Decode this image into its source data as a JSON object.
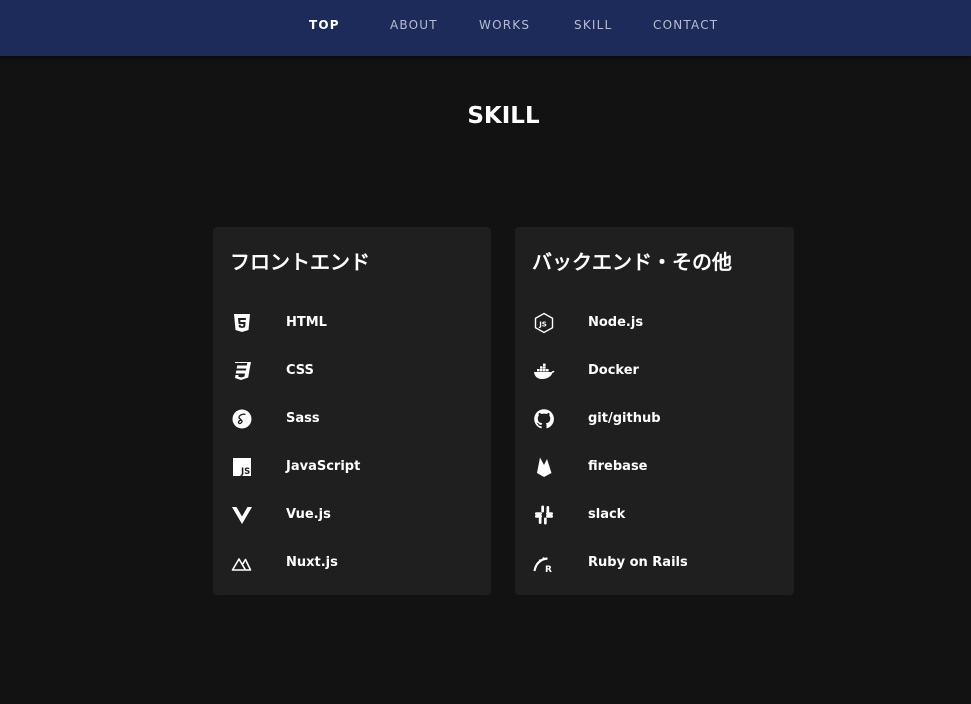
{
  "nav": {
    "items": [
      {
        "label": "TOP",
        "active": true
      },
      {
        "label": "ABOUT",
        "active": false
      },
      {
        "label": "WORKS",
        "active": false
      },
      {
        "label": "SKILL",
        "active": false
      },
      {
        "label": "CONTACT",
        "active": false
      }
    ]
  },
  "page": {
    "title": "SKILL"
  },
  "frontend": {
    "title": "フロントエンド",
    "skills": [
      {
        "label": "HTML",
        "icon": "html5-icon"
      },
      {
        "label": "CSS",
        "icon": "css3-icon"
      },
      {
        "label": "Sass",
        "icon": "sass-icon"
      },
      {
        "label": "JavaScript",
        "icon": "javascript-icon"
      },
      {
        "label": "Vue.js",
        "icon": "vuejs-icon"
      },
      {
        "label": "Nuxt.js",
        "icon": "nuxtjs-icon"
      }
    ]
  },
  "backend": {
    "title": "バックエンド・その他",
    "skills": [
      {
        "label": "Node.js",
        "icon": "nodejs-icon"
      },
      {
        "label": "Docker",
        "icon": "docker-icon"
      },
      {
        "label": "git/github",
        "icon": "github-icon"
      },
      {
        "label": "firebase",
        "icon": "firebase-icon"
      },
      {
        "label": "slack",
        "icon": "slack-icon"
      },
      {
        "label": "Ruby on Rails",
        "icon": "rails-icon"
      }
    ]
  },
  "colors": {
    "header": "#1c2b5a",
    "background": "#121212",
    "card": "#1f1f1f",
    "nav_inactive": "#b7bdd0"
  }
}
